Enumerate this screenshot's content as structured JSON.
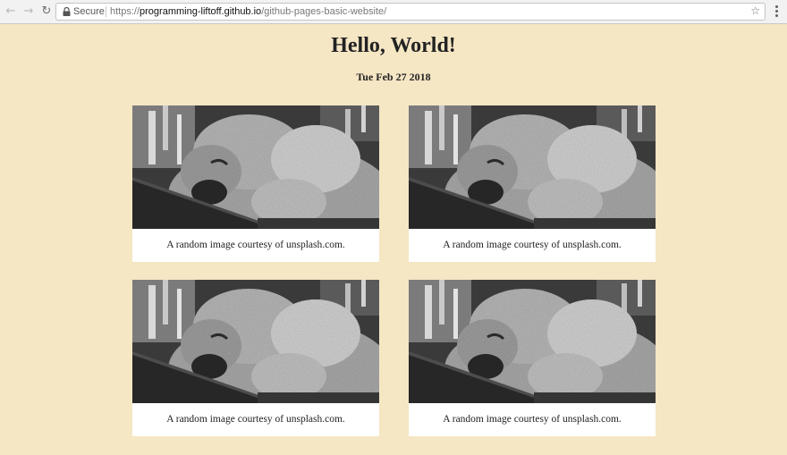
{
  "browser": {
    "secure_label": "Secure",
    "url_scheme": "https://",
    "url_host": "programming-liftoff.github.io",
    "url_path": "/github-pages-basic-website/"
  },
  "page": {
    "title": "Hello, World!",
    "date": "Tue Feb 27 2018"
  },
  "cards": [
    {
      "caption": "A random image courtesy of unsplash.com.",
      "image": "koala-photo"
    },
    {
      "caption": "A random image courtesy of unsplash.com.",
      "image": "koala-photo"
    },
    {
      "caption": "A random image courtesy of unsplash.com.",
      "image": "koala-photo"
    },
    {
      "caption": "A random image courtesy of unsplash.com.",
      "image": "koala-photo"
    }
  ],
  "colors": {
    "page_background": "#f5e6c4",
    "card_background": "#ffffff"
  }
}
